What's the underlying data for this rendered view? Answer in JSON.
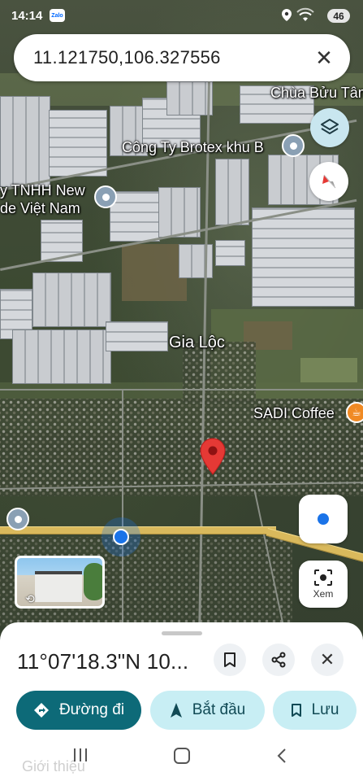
{
  "status_bar": {
    "time": "14:14",
    "zalo_label": "Zalo",
    "battery": "46"
  },
  "search": {
    "query": "11.121750,106.327556",
    "close_icon": "close-icon"
  },
  "map": {
    "labels": {
      "chua_buu_tam": "Chùa Bửu Tâm",
      "brotex": "Công Ty Brotex khu B",
      "tnhh_line1": "y TNHH New",
      "tnhh_line2": "de Việt Nam",
      "gia_loc": "Gia Lộc",
      "sadi_coffee": "SADI Coffee"
    },
    "view_button_label": "Xem"
  },
  "place_sheet": {
    "title": "11°07'18.3\"N 10...",
    "actions": {
      "directions": "Đường đi",
      "start": "Bắt đầu",
      "save": "Lưu"
    },
    "tab_intro": "Giới thiệu"
  },
  "colors": {
    "primary_button": "#0d6a78",
    "secondary_button": "#c8eef4",
    "pin_red": "#e53935",
    "location_blue": "#1a73e8"
  }
}
